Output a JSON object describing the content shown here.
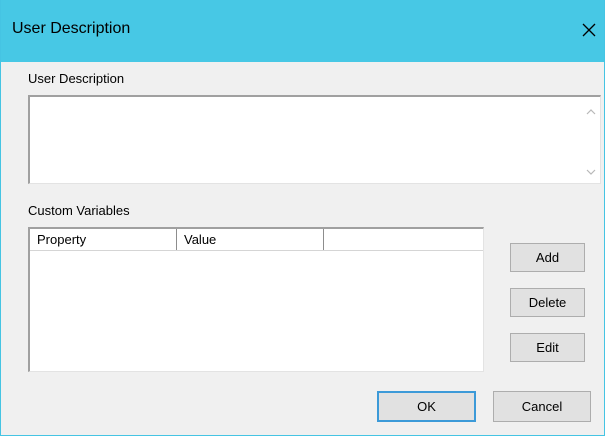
{
  "window": {
    "title": "User Description"
  },
  "description": {
    "label": "User Description",
    "value": ""
  },
  "custom_vars": {
    "label": "Custom Variables",
    "columns": [
      "Property",
      "Value",
      ""
    ],
    "rows": []
  },
  "buttons": {
    "add": "Add",
    "delete": "Delete",
    "edit": "Edit",
    "ok": "OK",
    "cancel": "Cancel"
  },
  "icons": {
    "close": "close-icon",
    "scroll_up": "chevron-up-icon",
    "scroll_down": "chevron-down-icon"
  },
  "colors": {
    "titlebar": "#47c8e5",
    "default_button_border": "#3c9ad8"
  }
}
